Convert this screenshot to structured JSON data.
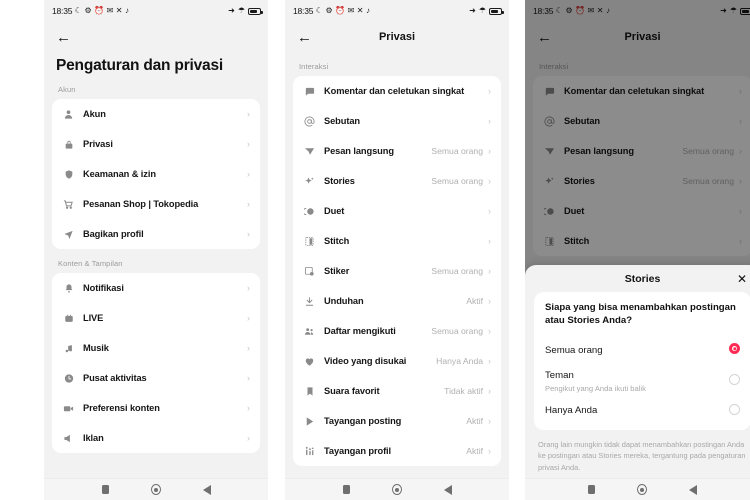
{
  "statusbar": {
    "time": "18:35",
    "icons": [
      "moon-icon",
      "settings-gear-icon",
      "alarm-clock-icon",
      "mail-icon",
      "x-app-icon",
      "tiktok-note-icon"
    ],
    "right_icons": [
      "airplane-mode-icon",
      "wifi-icon",
      "battery-icon"
    ]
  },
  "navbar": {
    "recents_label": "recents",
    "home_label": "home",
    "back_label": "back"
  },
  "panel1": {
    "back": "←",
    "title": "Pengaturan dan privasi",
    "sections": [
      {
        "label": "Akun",
        "items": [
          {
            "icon": "person-icon",
            "label": "Akun",
            "value": "",
            "chevron": "›"
          },
          {
            "icon": "lock-icon",
            "label": "Privasi",
            "value": "",
            "chevron": "›"
          },
          {
            "icon": "shield-icon",
            "label": "Keamanan & izin",
            "value": "",
            "chevron": "›"
          },
          {
            "icon": "cart-icon",
            "label": "Pesanan Shop | Tokopedia",
            "value": "",
            "chevron": "›"
          },
          {
            "icon": "share-icon",
            "label": "Bagikan profil",
            "value": "",
            "chevron": "›"
          }
        ]
      },
      {
        "label": "Konten & Tampilan",
        "items": [
          {
            "icon": "bell-icon",
            "label": "Notifikasi",
            "value": "",
            "chevron": "›"
          },
          {
            "icon": "live-icon",
            "label": "LIVE",
            "value": "",
            "chevron": "›"
          },
          {
            "icon": "music-note-icon",
            "label": "Musik",
            "value": "",
            "chevron": "›"
          },
          {
            "icon": "clock-icon",
            "label": "Pusat aktivitas",
            "value": "",
            "chevron": "›"
          },
          {
            "icon": "video-camera-icon",
            "label": "Preferensi konten",
            "value": "",
            "chevron": "›"
          },
          {
            "icon": "megaphone-icon",
            "label": "Iklan",
            "value": "",
            "chevron": "›"
          }
        ]
      }
    ]
  },
  "panel2": {
    "back": "←",
    "title": "Privasi",
    "section_label": "Interaksi",
    "items": [
      {
        "icon": "comment-bubble-icon",
        "label": "Komentar dan celetukan singkat",
        "value": "",
        "chevron": "›"
      },
      {
        "icon": "at-mention-icon",
        "label": "Sebutan",
        "value": "",
        "chevron": "›"
      },
      {
        "icon": "paper-plane-icon",
        "label": "Pesan langsung",
        "value": "Semua orang",
        "chevron": "›"
      },
      {
        "icon": "sparkle-icon",
        "label": "Stories",
        "value": "Semua orang",
        "chevron": "›"
      },
      {
        "icon": "duet-icon",
        "label": "Duet",
        "value": "",
        "chevron": "›"
      },
      {
        "icon": "stitch-icon",
        "label": "Stitch",
        "value": "",
        "chevron": "›"
      },
      {
        "icon": "sticker-icon",
        "label": "Stiker",
        "value": "Semua orang",
        "chevron": "›"
      },
      {
        "icon": "download-icon",
        "label": "Unduhan",
        "value": "Aktif",
        "chevron": "›"
      },
      {
        "icon": "following-list-icon",
        "label": "Daftar mengikuti",
        "value": "Semua orang",
        "chevron": "›"
      },
      {
        "icon": "heart-icon",
        "label": "Video yang disukai",
        "value": "Hanya Anda",
        "chevron": "›"
      },
      {
        "icon": "bookmark-icon",
        "label": "Suara favorit",
        "value": "Tidak aktif",
        "chevron": "›"
      },
      {
        "icon": "play-icon",
        "label": "Tayangan posting",
        "value": "Aktif",
        "chevron": "›"
      },
      {
        "icon": "profile-views-icon",
        "label": "Tayangan profil",
        "value": "Aktif",
        "chevron": "›"
      }
    ]
  },
  "panel3": {
    "back": "←",
    "title": "Privasi",
    "section_label": "Interaksi",
    "items": [
      {
        "icon": "comment-bubble-icon",
        "label": "Komentar dan celetukan singkat",
        "value": "",
        "chevron": "›"
      },
      {
        "icon": "at-mention-icon",
        "label": "Sebutan",
        "value": "",
        "chevron": "›"
      },
      {
        "icon": "paper-plane-icon",
        "label": "Pesan langsung",
        "value": "Semua orang",
        "chevron": "›"
      },
      {
        "icon": "sparkle-icon",
        "label": "Stories",
        "value": "Semua orang",
        "chevron": "›"
      },
      {
        "icon": "duet-icon",
        "label": "Duet",
        "value": "",
        "chevron": "›"
      },
      {
        "icon": "stitch-icon",
        "label": "Stitch",
        "value": "",
        "chevron": "›"
      }
    ],
    "sheet": {
      "title": "Stories",
      "close": "✕",
      "question": "Siapa yang bisa menambahkan postingan atau Stories Anda?",
      "options": [
        {
          "title": "Semua orang",
          "sub": "",
          "selected": true
        },
        {
          "title": "Teman",
          "sub": "Pengikut yang Anda ikuti balik",
          "selected": false
        },
        {
          "title": "Hanya Anda",
          "sub": "",
          "selected": false
        }
      ],
      "footnote": "Orang lain mungkin tidak dapat menambahkan postingan Anda ke postingan atau Stories mereka, tergantung pada pengaturan privasi Anda.",
      "accent_color": "#fe2c55"
    }
  }
}
